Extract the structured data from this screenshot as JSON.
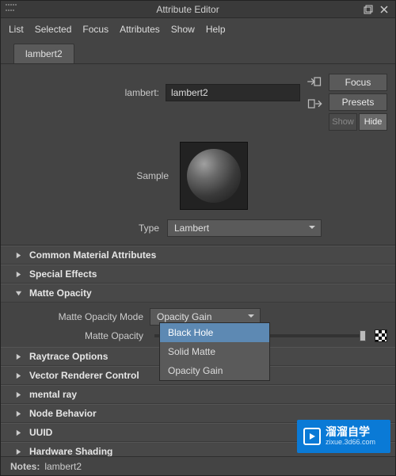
{
  "window": {
    "title": "Attribute Editor"
  },
  "menu": [
    "List",
    "Selected",
    "Focus",
    "Attributes",
    "Show",
    "Help"
  ],
  "tab": {
    "label": "lambert2"
  },
  "header": {
    "field_label": "lambert:",
    "field_value": "lambert2",
    "buttons": {
      "focus": "Focus",
      "presets": "Presets",
      "show": "Show",
      "hide": "Hide"
    }
  },
  "sample": {
    "label": "Sample"
  },
  "type_row": {
    "label": "Type",
    "value": "Lambert"
  },
  "sections": [
    {
      "name": "Common Material Attributes",
      "open": false
    },
    {
      "name": "Special Effects",
      "open": false
    },
    {
      "name": "Matte Opacity",
      "open": true
    },
    {
      "name": "Raytrace Options",
      "open": false
    },
    {
      "name": "Vector Renderer Control",
      "open": false
    },
    {
      "name": "mental ray",
      "open": false
    },
    {
      "name": "Node Behavior",
      "open": false
    },
    {
      "name": "UUID",
      "open": false
    },
    {
      "name": "Hardware Shading",
      "open": false
    }
  ],
  "matte": {
    "mode_label": "Matte Opacity Mode",
    "mode_value": "Opacity Gain",
    "opacity_label": "Matte Opacity",
    "options": [
      "Black Hole",
      "Solid Matte",
      "Opacity Gain"
    ],
    "highlighted": "Black Hole"
  },
  "notes": {
    "label": "Notes:",
    "value": "lambert2"
  },
  "brand": {
    "line1": "溜溜自学",
    "line2": "zixue.3d66.com"
  }
}
